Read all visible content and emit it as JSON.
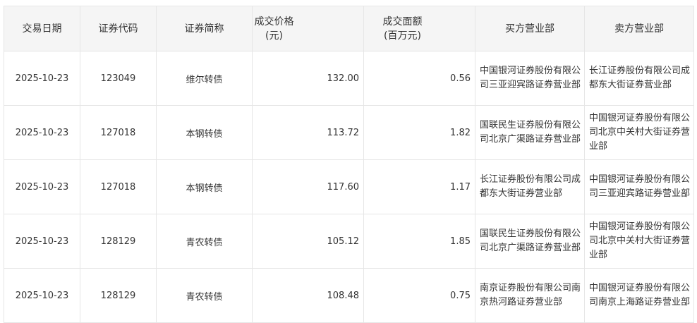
{
  "table": {
    "headers": {
      "date": "交易日期",
      "code": "证券代码",
      "name": "证券简称",
      "price_l1": "成交价格",
      "price_l2": "(元)",
      "amount_l1": "成交面额",
      "amount_l2": "(百万元)",
      "buyer": "买方营业部",
      "seller": "卖方营业部"
    },
    "rows": [
      {
        "date": "2025-10-23",
        "code": "123049",
        "name": "维尔转债",
        "price": "132.00",
        "amount": "0.56",
        "buyer": "中国银河证券股份有限公司三亚迎宾路证券营业部",
        "seller": "长江证券股份有限公司成都东大街证券营业部"
      },
      {
        "date": "2025-10-23",
        "code": "127018",
        "name": "本钢转债",
        "price": "113.72",
        "amount": "1.82",
        "buyer": "国联民生证券股份有限公司北京广渠路证券营业部",
        "seller": "中国银河证券股份有限公司北京中关村大街证券营业部"
      },
      {
        "date": "2025-10-23",
        "code": "127018",
        "name": "本钢转债",
        "price": "117.60",
        "amount": "1.17",
        "buyer": "长江证券股份有限公司成都东大街证券营业部",
        "seller": "中国银河证券股份有限公司三亚迎宾路证券营业部"
      },
      {
        "date": "2025-10-23",
        "code": "128129",
        "name": "青农转债",
        "price": "105.12",
        "amount": "1.85",
        "buyer": "国联民生证券股份有限公司北京广渠路证券营业部",
        "seller": "中国银河证券股份有限公司北京中关村大街证券营业部"
      },
      {
        "date": "2025-10-23",
        "code": "128129",
        "name": "青农转债",
        "price": "108.48",
        "amount": "0.75",
        "buyer": "南京证券股份有限公司南京热河路证券营业部",
        "seller": "中国银河证券股份有限公司南京上海路证券营业部"
      }
    ]
  }
}
